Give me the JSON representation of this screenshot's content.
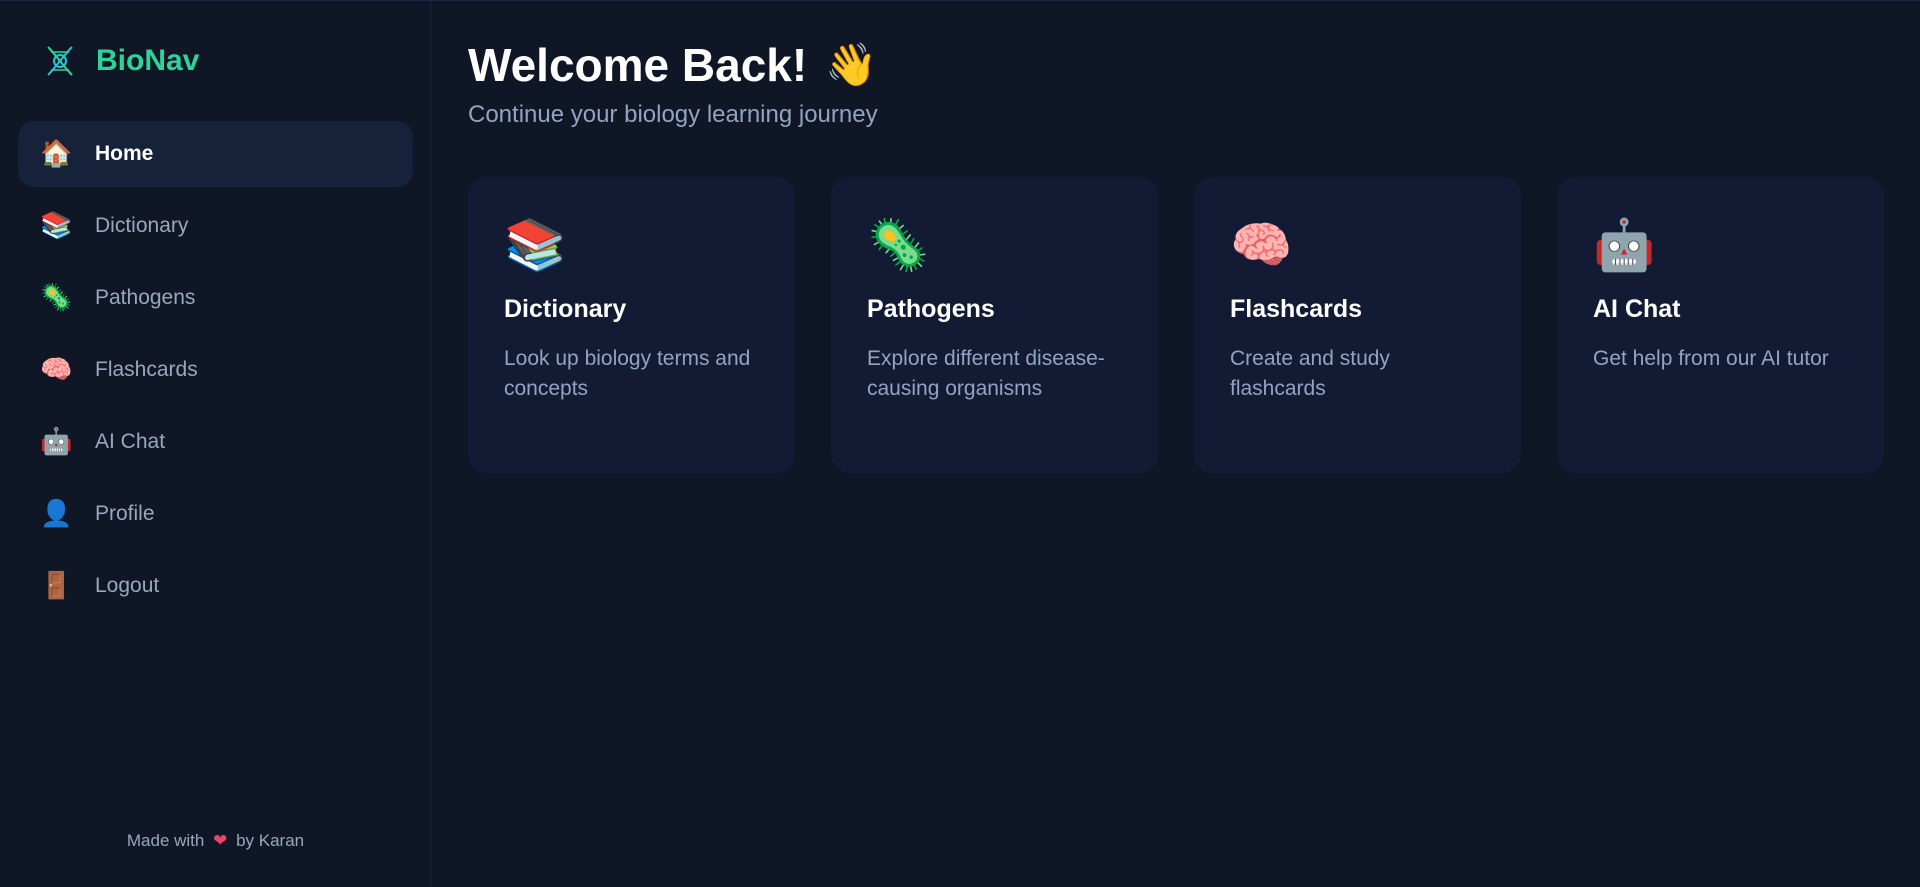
{
  "brand": {
    "name": "BioNav",
    "icon": "dna-microscope-icon"
  },
  "nav": {
    "items": [
      {
        "label": "Home",
        "icon": "🏠"
      },
      {
        "label": "Dictionary",
        "icon": "📚"
      },
      {
        "label": "Pathogens",
        "icon": "🦠"
      },
      {
        "label": "Flashcards",
        "icon": "🧠"
      },
      {
        "label": "AI Chat",
        "icon": "🤖"
      },
      {
        "label": "Profile",
        "icon": "👤"
      },
      {
        "label": "Logout",
        "icon": "🚪"
      }
    ],
    "active": "Home"
  },
  "footer": {
    "prefix": "Made with",
    "heart": "❤",
    "suffix": "by Karan"
  },
  "header": {
    "title": "Welcome Back!",
    "wave": "👋",
    "subtitle": "Continue your biology learning journey"
  },
  "cards": [
    {
      "icon": "📚",
      "title": "Dictionary",
      "desc": "Look up biology terms and concepts"
    },
    {
      "icon": "🦠",
      "title": "Pathogens",
      "desc": "Explore different disease-causing organisms"
    },
    {
      "icon": "🧠",
      "title": "Flashcards",
      "desc": "Create and study flashcards"
    },
    {
      "icon": "🤖",
      "title": "AI Chat",
      "desc": "Get help from our AI tutor"
    }
  ],
  "colors": {
    "accent": "#2dd49a",
    "background": "#0f1626",
    "card": "#121b33",
    "active_nav": "#16213a"
  }
}
